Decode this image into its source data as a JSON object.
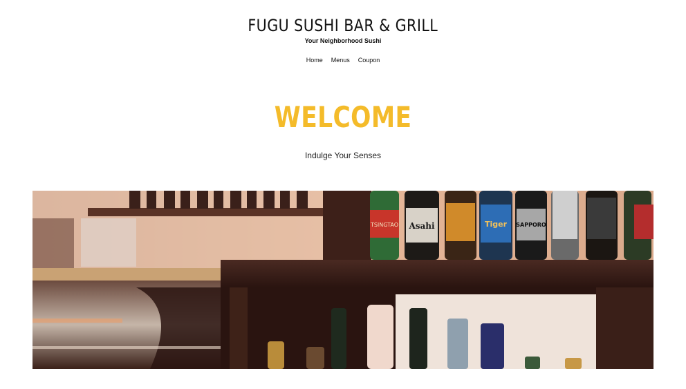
{
  "header": {
    "title": "FUGU SUSHI BAR & GRILL",
    "tagline": "Your Neighborhood Sushi"
  },
  "nav": {
    "items": [
      {
        "label": "Home"
      },
      {
        "label": "Menus"
      },
      {
        "label": "Coupon"
      }
    ]
  },
  "hero": {
    "heading": "WELCOME",
    "subheading": "Indulge Your Senses",
    "heading_color": "#f4bb2a"
  },
  "banner": {
    "bottle_labels": [
      "TSINGTAO",
      "Asahi",
      "Tiger",
      "SAPPORO"
    ]
  }
}
